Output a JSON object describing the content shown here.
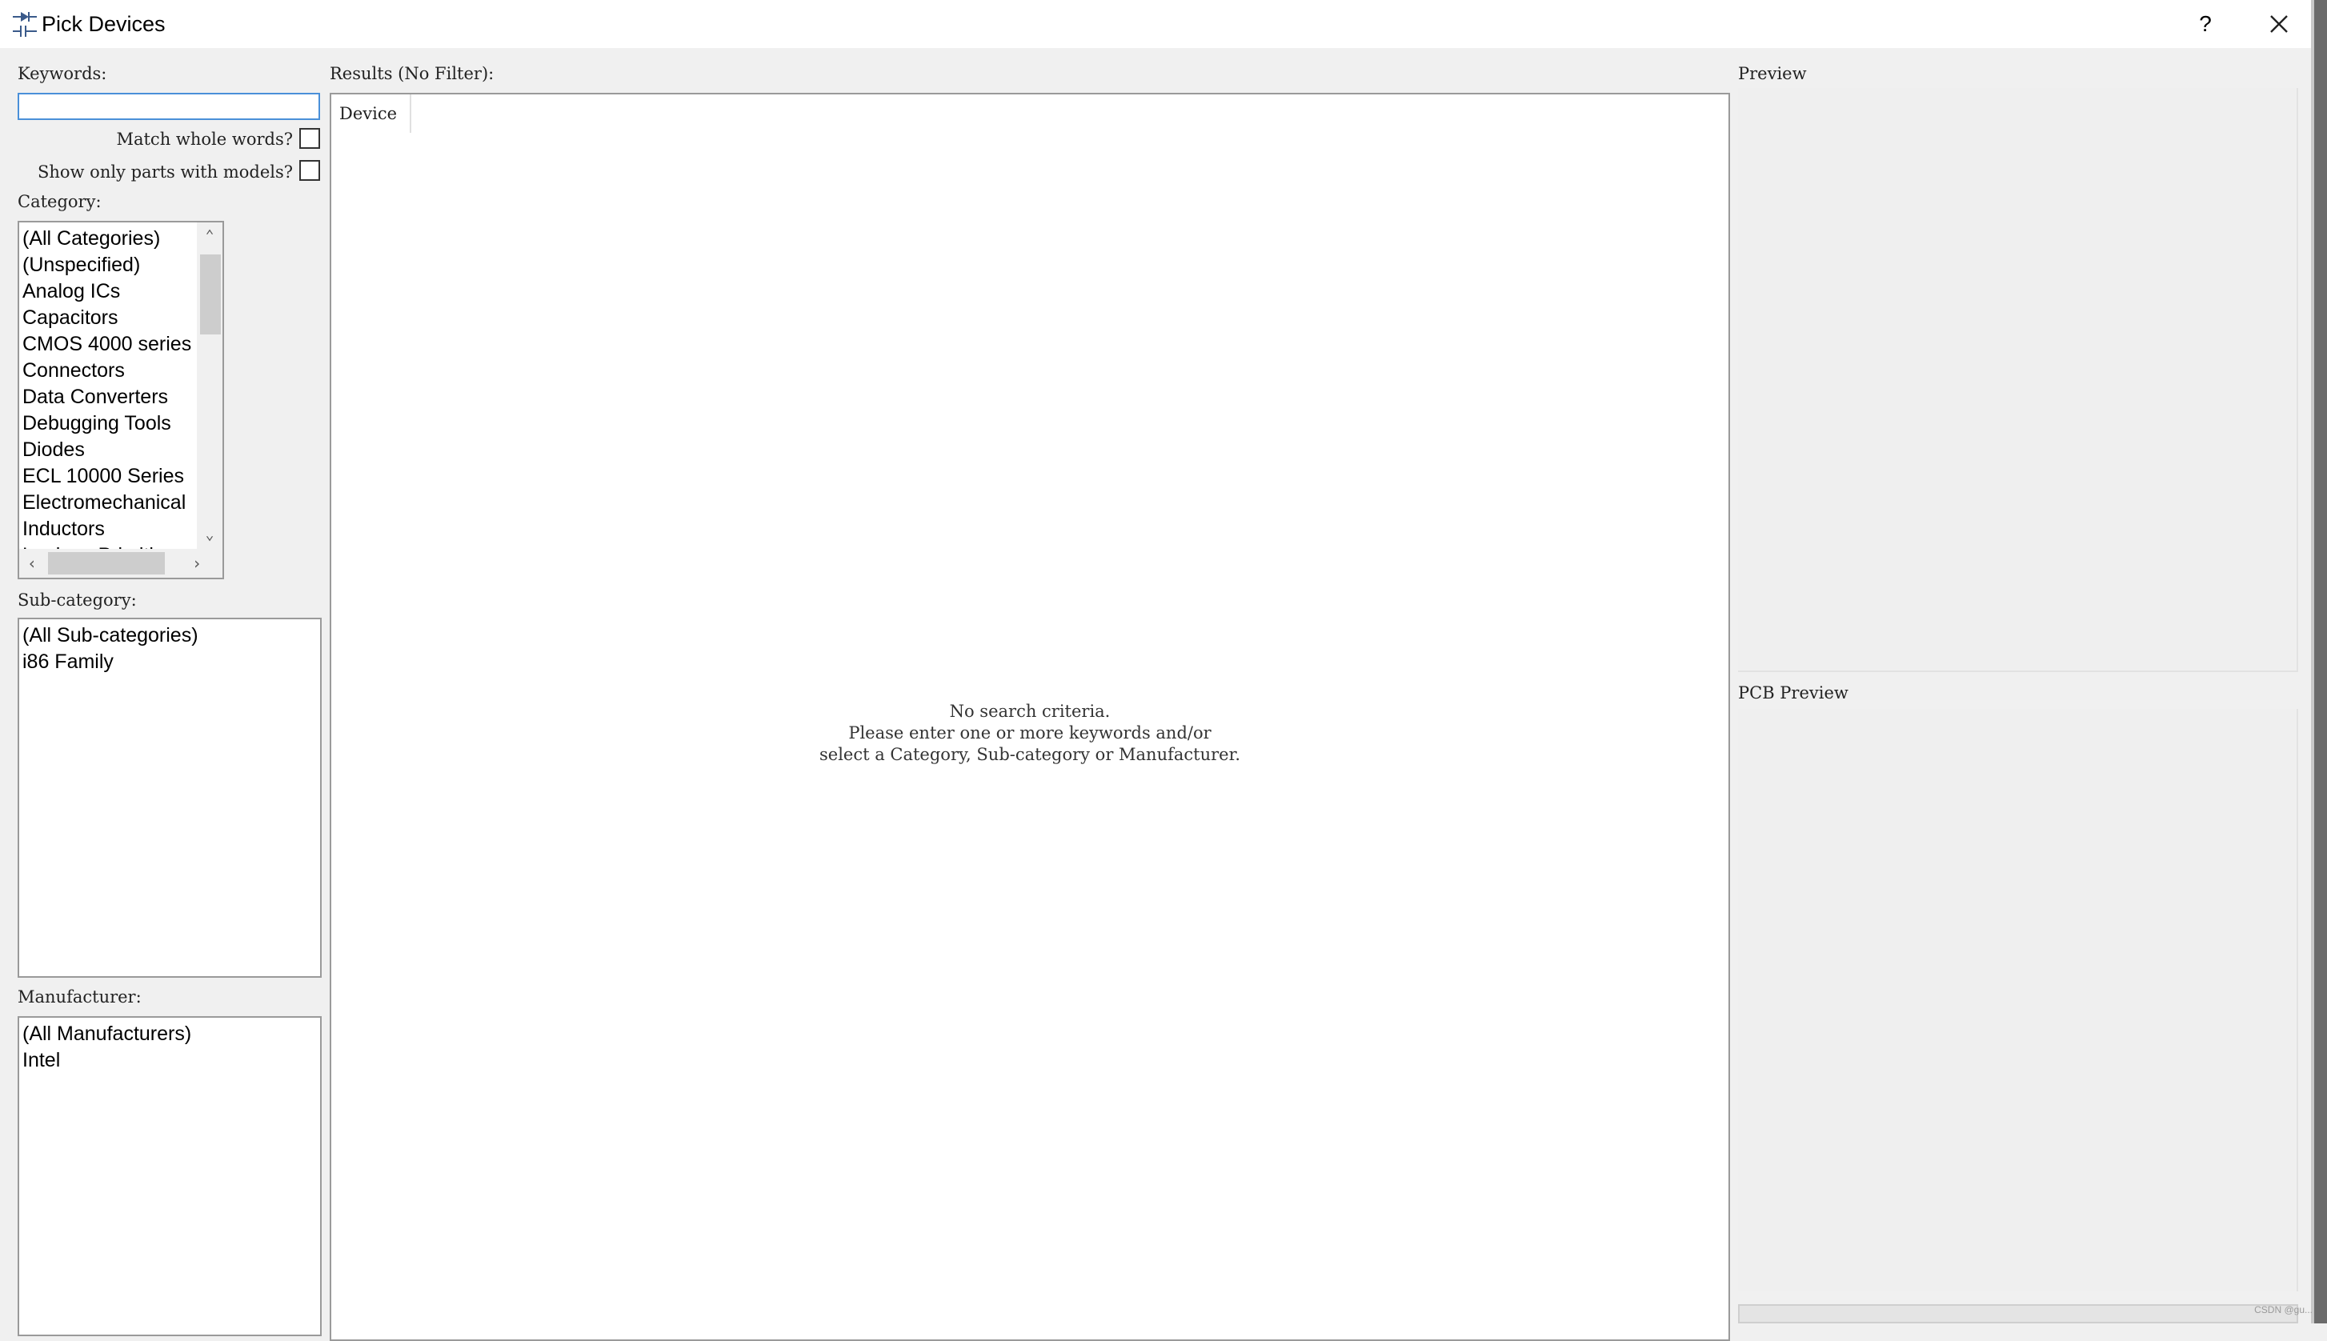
{
  "window": {
    "title": "Pick Devices",
    "help_label": "?",
    "close_icon": "close-icon",
    "app_icon": "diode-component-icon"
  },
  "filters": {
    "keywords_label": "Keywords:",
    "keywords_value": "",
    "match_whole_words_label": "Match whole words?",
    "match_whole_words_checked": false,
    "models_only_label": "Show only parts with models?",
    "models_only_checked": false,
    "category_label": "Category:",
    "categories": [
      "(All Categories)",
      "(Unspecified)",
      "Analog ICs",
      "Capacitors",
      "CMOS 4000 series",
      "Connectors",
      "Data Converters",
      "Debugging Tools",
      "Diodes",
      "ECL 10000 Series",
      "Electromechanical",
      "Inductors",
      "Laplace Primitives"
    ],
    "subcategory_label": "Sub-category:",
    "subcategories": [
      "(All Sub-categories)",
      "i86 Family"
    ],
    "manufacturer_label": "Manufacturer:",
    "manufacturers": [
      "(All Manufacturers)",
      "Intel"
    ]
  },
  "results": {
    "label": "Results (No Filter):",
    "column_device": "Device",
    "empty_message": "No search criteria.\nPlease enter one or more keywords and/or\nselect a Category, Sub-category or Manufacturer."
  },
  "preview": {
    "label": "Preview",
    "pcb_label": "PCB Preview"
  },
  "watermark": "CSDN @gu..."
}
